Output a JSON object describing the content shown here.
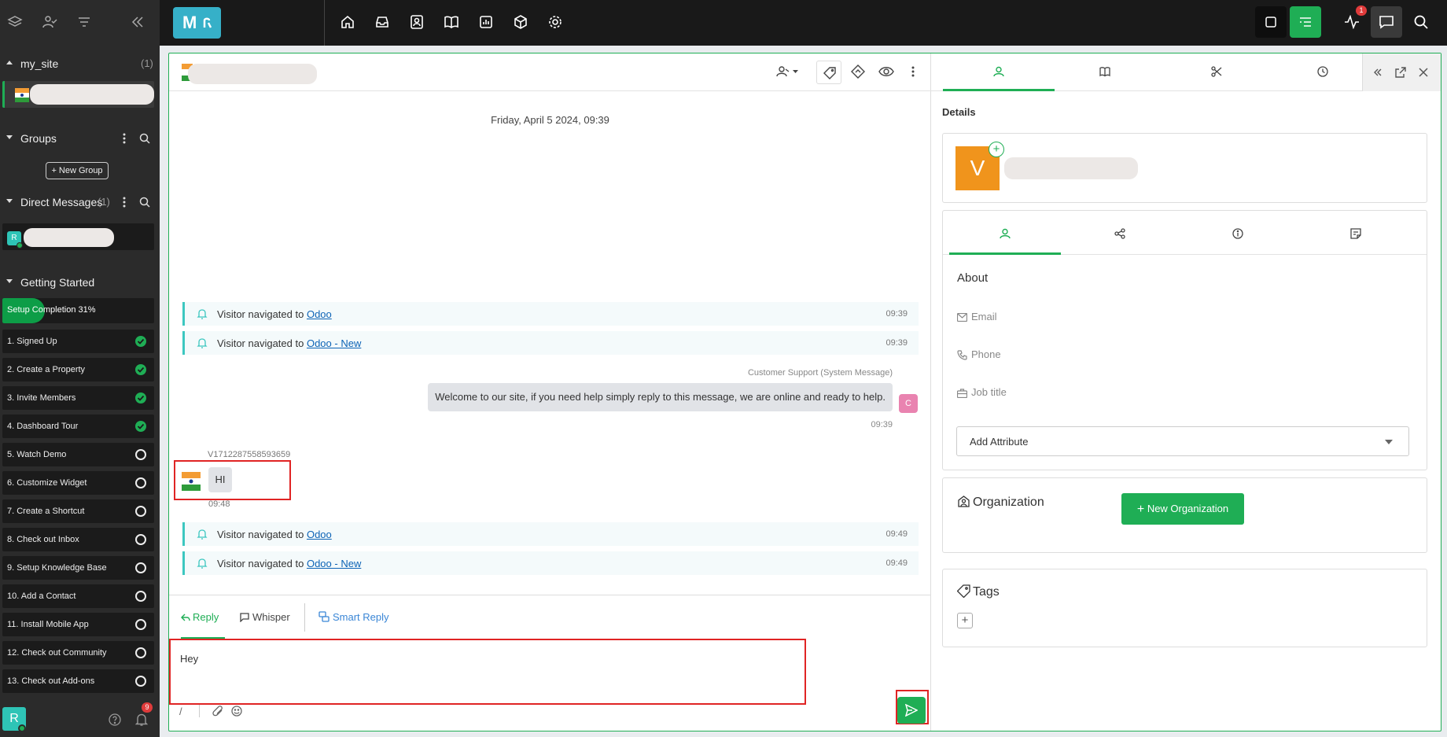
{
  "sidebar": {
    "site": {
      "name": "my_site",
      "count": "(1)"
    },
    "groups": {
      "label": "Groups",
      "new_group": "+ New Group"
    },
    "dms": {
      "label": "Direct Messages",
      "count": "(1)",
      "avatar_letter": "R"
    },
    "getting_started": {
      "label": "Getting Started",
      "progress_label": "Setup Completion 31%",
      "progress_percent": 31,
      "tasks": [
        {
          "label": "1. Signed Up",
          "done": true
        },
        {
          "label": "2. Create a Property",
          "done": true
        },
        {
          "label": "3. Invite Members",
          "done": true
        },
        {
          "label": "4. Dashboard Tour",
          "done": true
        },
        {
          "label": "5. Watch Demo",
          "done": false
        },
        {
          "label": "6. Customize Widget",
          "done": false
        },
        {
          "label": "7. Create a Shortcut",
          "done": false
        },
        {
          "label": "8. Check out Inbox",
          "done": false
        },
        {
          "label": "9. Setup Knowledge Base",
          "done": false
        },
        {
          "label": "10. Add a Contact",
          "done": false
        },
        {
          "label": "11. Install Mobile App",
          "done": false
        },
        {
          "label": "12. Check out Community",
          "done": false
        },
        {
          "label": "13. Check out Add-ons",
          "done": false
        }
      ]
    },
    "user_letter": "R",
    "notifications_count": "9"
  },
  "topbar": {
    "logo_text": "M",
    "activity_badge": "1",
    "colors": {
      "accent": "#1fae55",
      "logo": "#36b0c8"
    }
  },
  "chat": {
    "date": "Friday, April 5 2024, 09:39",
    "nav_prefix": "Visitor navigated to",
    "events_before": [
      {
        "page": "Odoo",
        "time": "09:39"
      },
      {
        "page": "Odoo - New",
        "time": "09:39"
      }
    ],
    "system_message": {
      "sender": "Customer Support (System Message)",
      "text": "Welcome to our site, if you need help simply reply to this message, we are online and ready to help.",
      "avatar": "C",
      "time": "09:39"
    },
    "visitor_message": {
      "visitor_id": "V1712287558593659",
      "text": "HI",
      "time": "09:48"
    },
    "events_after": [
      {
        "page": "Odoo",
        "time": "09:49"
      },
      {
        "page": "Odoo - New",
        "time": "09:49"
      }
    ]
  },
  "composer": {
    "tabs": {
      "reply": "Reply",
      "whisper": "Whisper",
      "smart_reply": "Smart Reply"
    },
    "value": "Hey",
    "shortcut_char": "/"
  },
  "details": {
    "title": "Details",
    "avatar_letter": "V",
    "about": {
      "title": "About",
      "email": "Email",
      "phone": "Phone",
      "job_title": "Job title",
      "add_attribute": "Add Attribute"
    },
    "organization": {
      "title": "Organization",
      "new_button": "New Organization"
    },
    "tags": {
      "title": "Tags"
    }
  }
}
